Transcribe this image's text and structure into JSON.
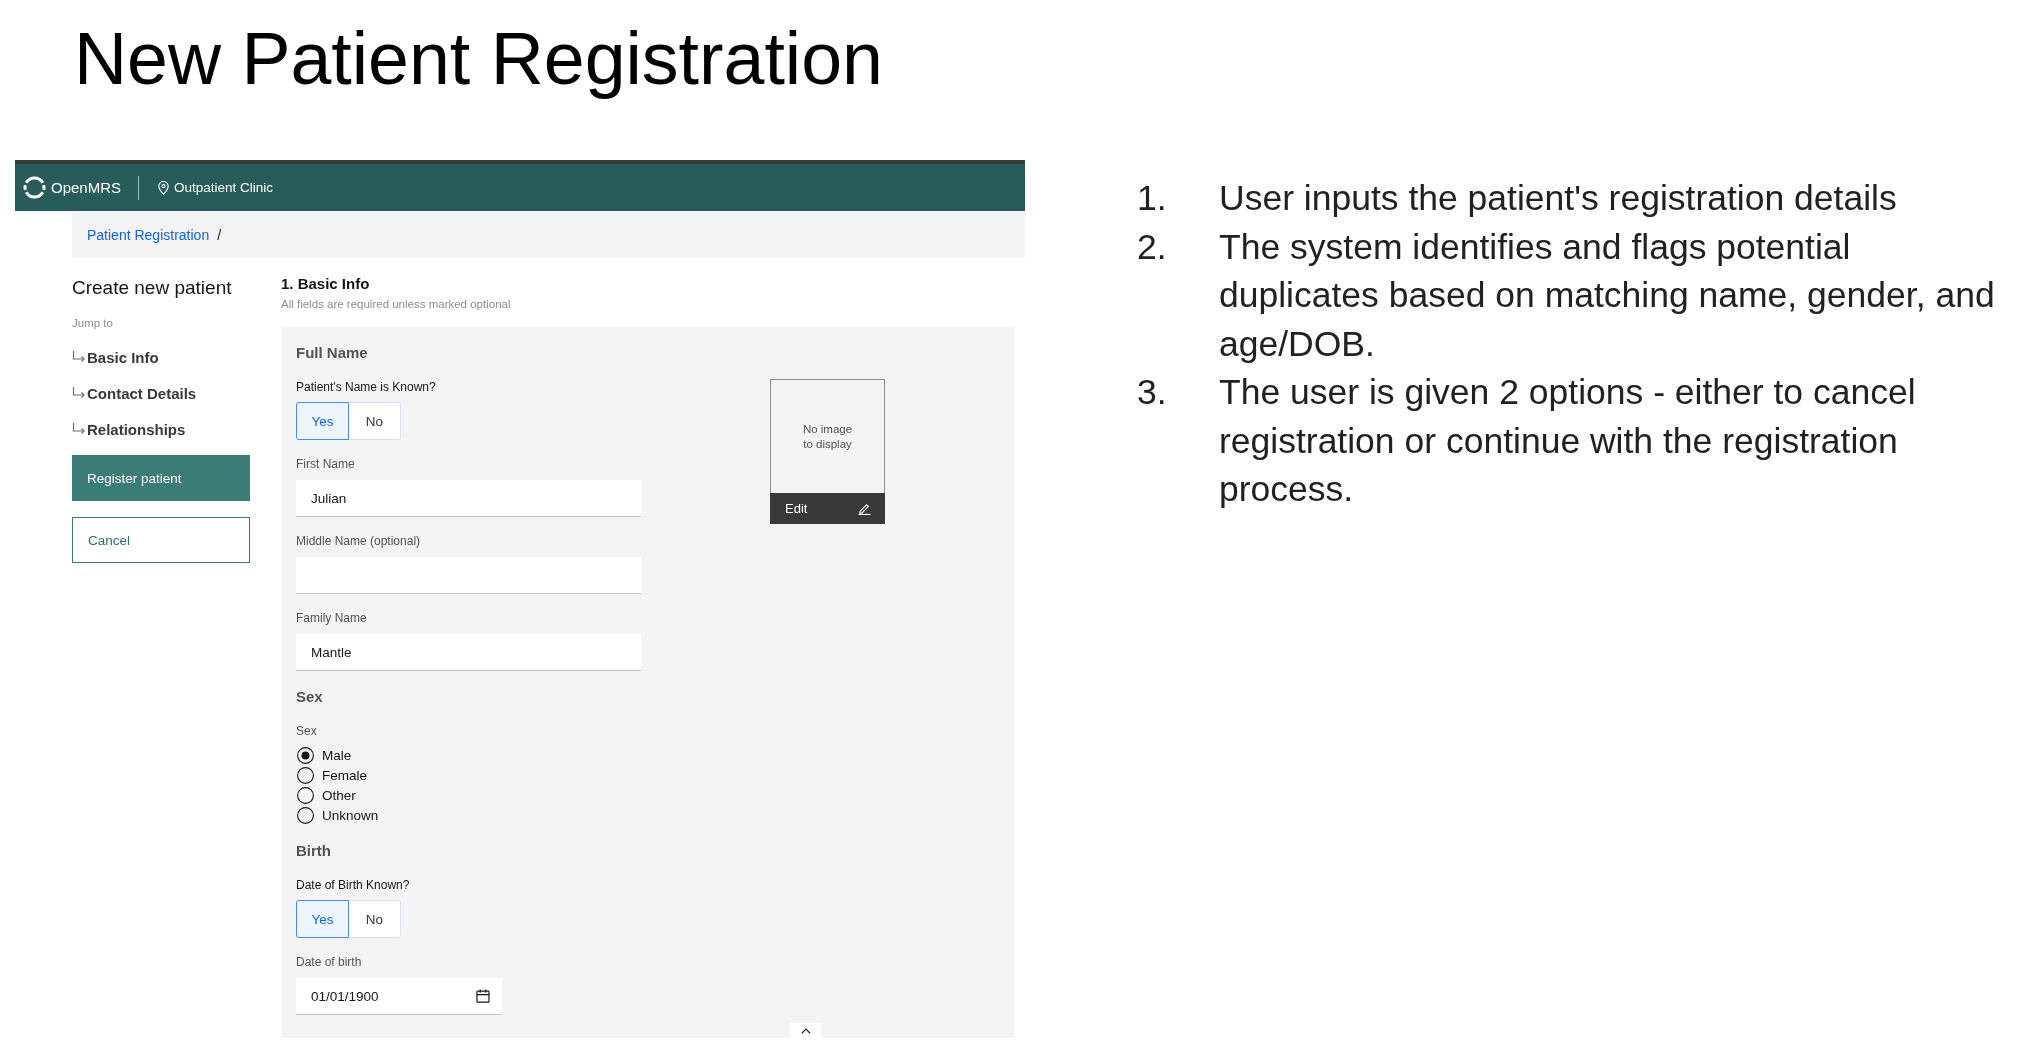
{
  "title": "New Patient Registration",
  "app": {
    "header": {
      "brand": "OpenMRS",
      "location": "Outpatient Clinic"
    },
    "breadcrumb": {
      "items": [
        "Patient Registration"
      ],
      "separator": "/"
    },
    "sidebar": {
      "title": "Create new patient",
      "jump_label": "Jump to",
      "links": [
        "Basic Info",
        "Contact Details",
        "Relationships"
      ],
      "buttons": [
        {
          "label": "Register patient",
          "kind": "primary"
        },
        {
          "label": "Cancel",
          "kind": "secondary"
        }
      ]
    },
    "form": {
      "title": "1. Basic Info",
      "note": "All fields are required unless marked optional",
      "blocks": [
        {
          "kind": "heading",
          "text": "Full Name"
        },
        {
          "kind": "toggle",
          "label": "Patient's Name is Known?",
          "options": [
            {
              "label": "Yes",
              "selected": true
            },
            {
              "label": "No",
              "selected": false
            }
          ]
        },
        {
          "kind": "text_field",
          "label": "First Name",
          "value": "Julian"
        },
        {
          "kind": "text_field",
          "label": "Middle Name (optional)"
        },
        {
          "kind": "text_field",
          "label": "Family Name",
          "value": "Mantle"
        },
        {
          "kind": "heading",
          "text": "Sex"
        },
        {
          "kind": "radio_group",
          "label": "Sex",
          "options": [
            {
              "label": "Male",
              "selected": true
            },
            {
              "label": "Female",
              "selected": false
            },
            {
              "label": "Other",
              "selected": false
            },
            {
              "label": "Unknown",
              "selected": false
            }
          ]
        },
        {
          "kind": "heading",
          "text": "Birth"
        },
        {
          "kind": "toggle",
          "label": "Date of Birth Known?",
          "options": [
            {
              "label": "Yes",
              "selected": true
            },
            {
              "label": "No",
              "selected": false
            }
          ]
        },
        {
          "kind": "date_field",
          "label": "Date of birth",
          "value": "01/01/1900"
        }
      ],
      "photo": {
        "message": "No image to display",
        "action": "Edit"
      }
    }
  },
  "steps": [
    {
      "number": "1.",
      "text": "User inputs the patient's registration details"
    },
    {
      "number": "2.",
      "text": "The system identifies and flags potential duplicates based on matching name, gender, and age/DOB."
    },
    {
      "number": "3.",
      "text": "The user is given 2 options - either to cancel registration or continue with the registration process."
    }
  ]
}
